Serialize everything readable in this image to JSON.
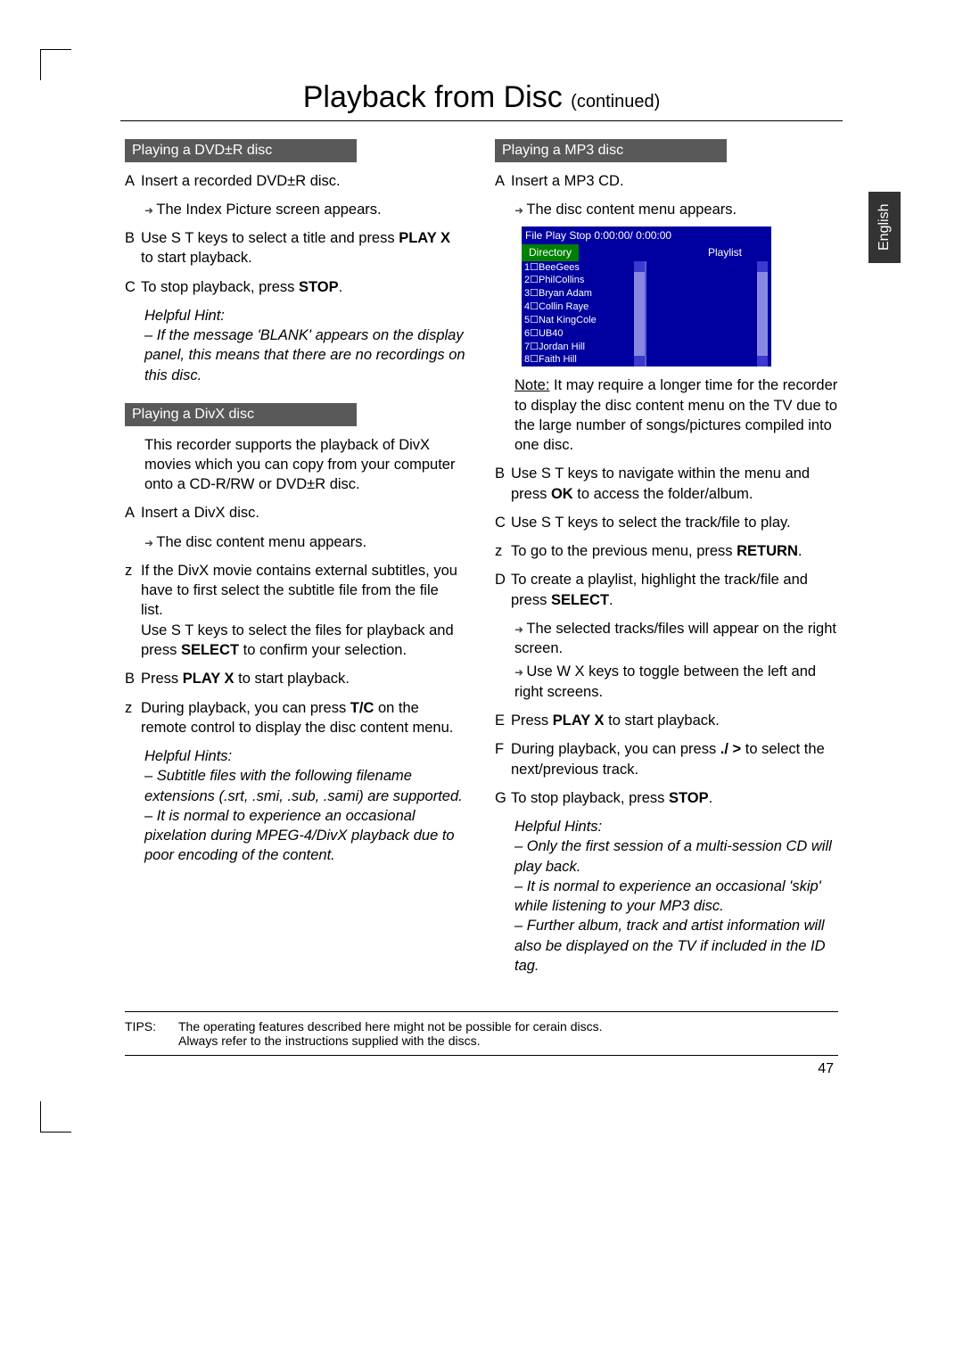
{
  "pageNumber": "47",
  "header": {
    "title": "Playback from Disc",
    "continued": "(continued)"
  },
  "sideTab": "English",
  "tips": {
    "label": "TIPS:",
    "line1": "The operating features described here might not be possible for cerain discs.",
    "line2": "Always refer to the instructions supplied with the discs."
  },
  "left": {
    "sec1": {
      "title": "Playing a DVD±R disc",
      "s1": "Insert a recorded DVD±R disc.",
      "s1a": "The Index Picture screen appears.",
      "s2a": "Use S T keys to select a title and press ",
      "s2b": "PLAY X",
      "s2c": " to start playback.",
      "s3a": "To stop playback, press ",
      "s3b": "STOP",
      "s3c": ".",
      "hintHead": "Helpful Hint:",
      "hint": "If the message 'BLANK' appears on the display panel, this means that there are no recordings on this disc."
    },
    "sec2": {
      "title": "Playing a DivX disc",
      "intro": "This recorder supports the playback of DivX movies which you can copy from your computer onto a CD-R/RW or DVD±R disc.",
      "s1": "Insert a DivX disc.",
      "s1a": "The disc content menu appears.",
      "z1": "If the DivX movie contains external subtitles, you have to first select the subtitle file from the file list.",
      "z1b": "Use S T keys to select the files for playback and press ",
      "z1b2": "SELECT",
      "z1b3": " to confirm your selection.",
      "s2a": "Press ",
      "s2b": "PLAY X",
      "s2c": " to start playback.",
      "z2a": "During playback, you can press ",
      "z2b": "T/C",
      "z2c": " on the remote control to display the disc content menu.",
      "h2Head": "Helpful Hints:",
      "h2a": "Subtitle files with the following filename extensions (.srt, .smi, .sub, .sami) are supported.",
      "h2b": "It is normal to experience an occasional pixelation during MPEG-4/DivX playback due to poor encoding of the content."
    }
  },
  "right": {
    "sec1": {
      "title": "Playing a MP3 disc",
      "s1": "Insert a MP3 CD.",
      "s1a": "The disc content menu appears.",
      "note": "Note:",
      "noteTxt": "  It may require a longer time for the recorder to display the disc content menu on the TV due to the large number of songs/pictures compiled into one disc.",
      "s2a": "Use S T keys to navigate within the menu and press ",
      "s2b": "OK",
      "s2c": " to access the folder/album.",
      "s3": "Use S T keys to select the track/file to play.",
      "z1a": "To go to the previous menu, press ",
      "z1b": "RETURN",
      "z1c": ".",
      "s4a": "To create a playlist, highlight the track/file and press ",
      "s4b": "SELECT",
      "s4c": ".",
      "s4d": "The selected tracks/files will appear on the right screen.",
      "s4e": "Use W X keys to toggle between the left and right screens.",
      "s5a": "Press ",
      "s5b": "PLAY X",
      "s5c": " to start playback.",
      "s6a": "During playback, you can press ",
      "s6b": "./ >",
      "s6c": " to select the next/previous track.",
      "s7a": "To stop playback, press ",
      "s7b": "STOP",
      "s7c": ".",
      "hHead": "Helpful Hints:",
      "h1": "Only the first session of a multi-session CD will play back.",
      "h2": "It is normal to experience an occasional 'skip' while listening to your MP3 disc.",
      "h3": "Further album, track and artist information will also be displayed on the TV if included in the ID tag."
    },
    "menu": {
      "top": "File Play Stop 0:00:00/ 0:00:00",
      "tabDir": "Directory",
      "tabPl": "Playlist",
      "items": [
        "1☐BeeGees",
        "2☐PhilCollins",
        "3☐Bryan Adam",
        "4☐Collin Raye",
        "5☐Nat KingCole",
        "6☐UB40",
        "7☐Jordan Hill",
        "8☐Faith Hill"
      ]
    }
  }
}
